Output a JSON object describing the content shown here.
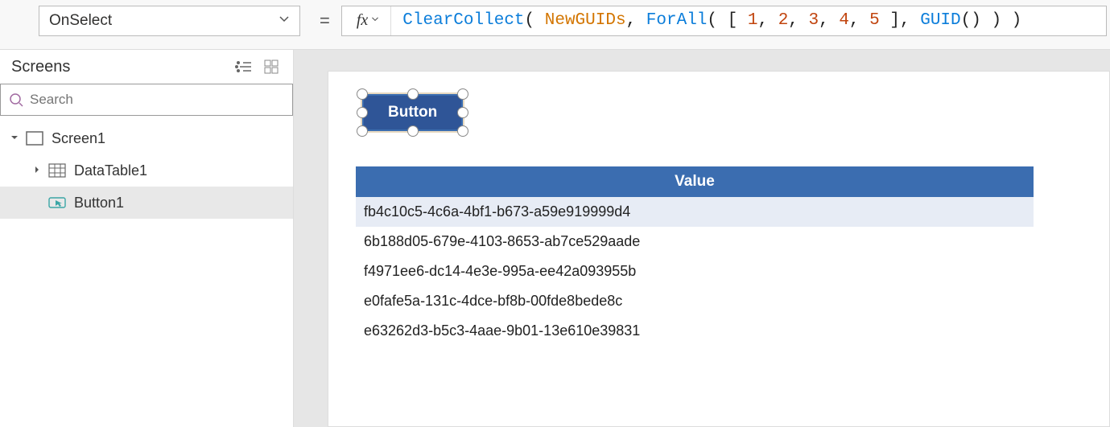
{
  "property_dropdown": {
    "value": "OnSelect"
  },
  "formula": {
    "tokens": [
      {
        "t": "fn",
        "v": "ClearCollect"
      },
      {
        "t": "br",
        "v": "( "
      },
      {
        "t": "ident",
        "v": "NewGUIDs"
      },
      {
        "t": "punct",
        "v": ", "
      },
      {
        "t": "fn",
        "v": "ForAll"
      },
      {
        "t": "br",
        "v": "( "
      },
      {
        "t": "br",
        "v": "[ "
      },
      {
        "t": "num",
        "v": "1"
      },
      {
        "t": "punct",
        "v": ", "
      },
      {
        "t": "num",
        "v": "2"
      },
      {
        "t": "punct",
        "v": ", "
      },
      {
        "t": "num",
        "v": "3"
      },
      {
        "t": "punct",
        "v": ", "
      },
      {
        "t": "num",
        "v": "4"
      },
      {
        "t": "punct",
        "v": ", "
      },
      {
        "t": "num",
        "v": "5"
      },
      {
        "t": "br",
        "v": " ]"
      },
      {
        "t": "punct",
        "v": ", "
      },
      {
        "t": "fn",
        "v": "GUID"
      },
      {
        "t": "br",
        "v": "()"
      },
      {
        "t": "br",
        "v": " )"
      },
      {
        "t": "br",
        "v": " )"
      }
    ]
  },
  "left_panel": {
    "title": "Screens",
    "search_placeholder": "Search",
    "tree": [
      {
        "label": "Screen1",
        "icon": "screen",
        "expanded": true,
        "depth": 0
      },
      {
        "label": "DataTable1",
        "icon": "table",
        "expanded": false,
        "depth": 1
      },
      {
        "label": "Button1",
        "icon": "button",
        "selected": true,
        "leaf": true,
        "depth": 1
      }
    ]
  },
  "canvas": {
    "button_text": "Button",
    "datatable": {
      "column_header": "Value",
      "rows": [
        "fb4c10c5-4c6a-4bf1-b673-a59e919999d4",
        "6b188d05-679e-4103-8653-ab7ce529aade",
        "f4971ee6-dc14-4e3e-995a-ee42a093955b",
        "e0fafe5a-131c-4dce-bf8b-00fde8bede8c",
        "e63262d3-b5c3-4aae-9b01-13e610e39831"
      ]
    }
  }
}
